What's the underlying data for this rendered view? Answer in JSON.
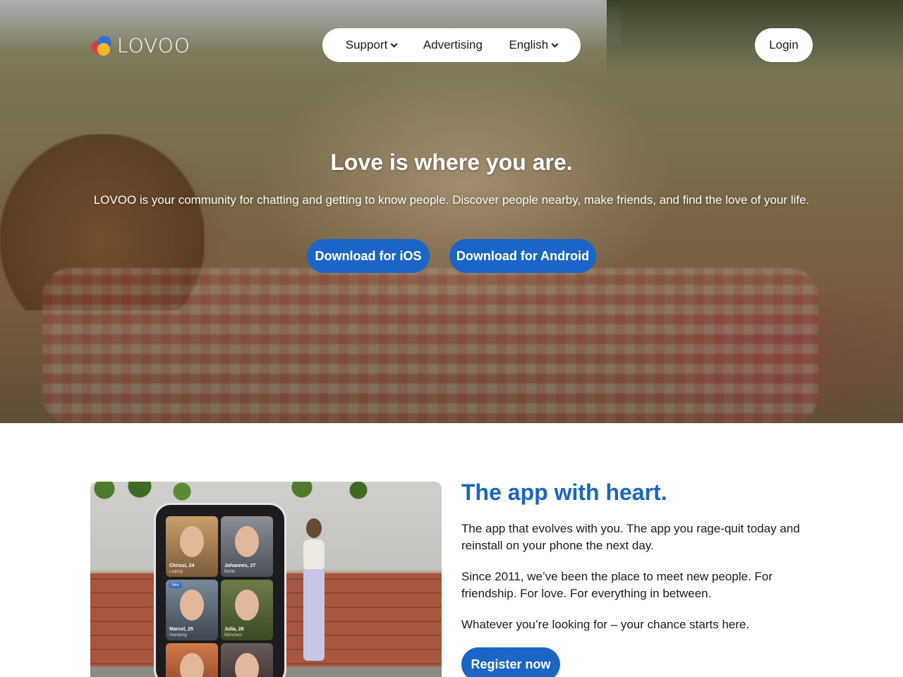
{
  "header": {
    "logo_text": "LOVOO",
    "nav": {
      "support_label": "Support",
      "advertising_label": "Advertising",
      "language_label": "English"
    },
    "login_label": "Login"
  },
  "hero": {
    "title": "Love is where you are.",
    "subtitle": "LOVOO is your community for chatting and getting to know people. Discover people nearby, make friends, and find the love of your life.",
    "ios_button": "Download for iOS",
    "android_button": "Download for Android"
  },
  "app_section": {
    "title": "The app with heart.",
    "paragraph_1": "The app that evolves with you. The app you rage-quit today and reinstall on your phone the next day.",
    "paragraph_2": "Since 2011, we’ve been the place to meet new people. For friendship. For love. For everything in between.",
    "paragraph_3": "Whatever you’re looking for – your chance starts here.",
    "register_button": "Register now",
    "phone_cards": [
      {
        "name": "Chrissi, 24",
        "city": "Leipzig"
      },
      {
        "name": "Johannes, 27",
        "city": "Berlin"
      },
      {
        "name": "Marcel, 25",
        "city": "Hamburg",
        "badge": "Neu"
      },
      {
        "name": "Julia, 26",
        "city": "München"
      },
      {
        "name": "",
        "city": ""
      },
      {
        "name": "",
        "city": ""
      }
    ]
  },
  "colors": {
    "accent_blue": "#1b65c8",
    "logo_red": "#e23b3b",
    "logo_blue": "#2f6fd1",
    "logo_yellow": "#f3b52a"
  }
}
